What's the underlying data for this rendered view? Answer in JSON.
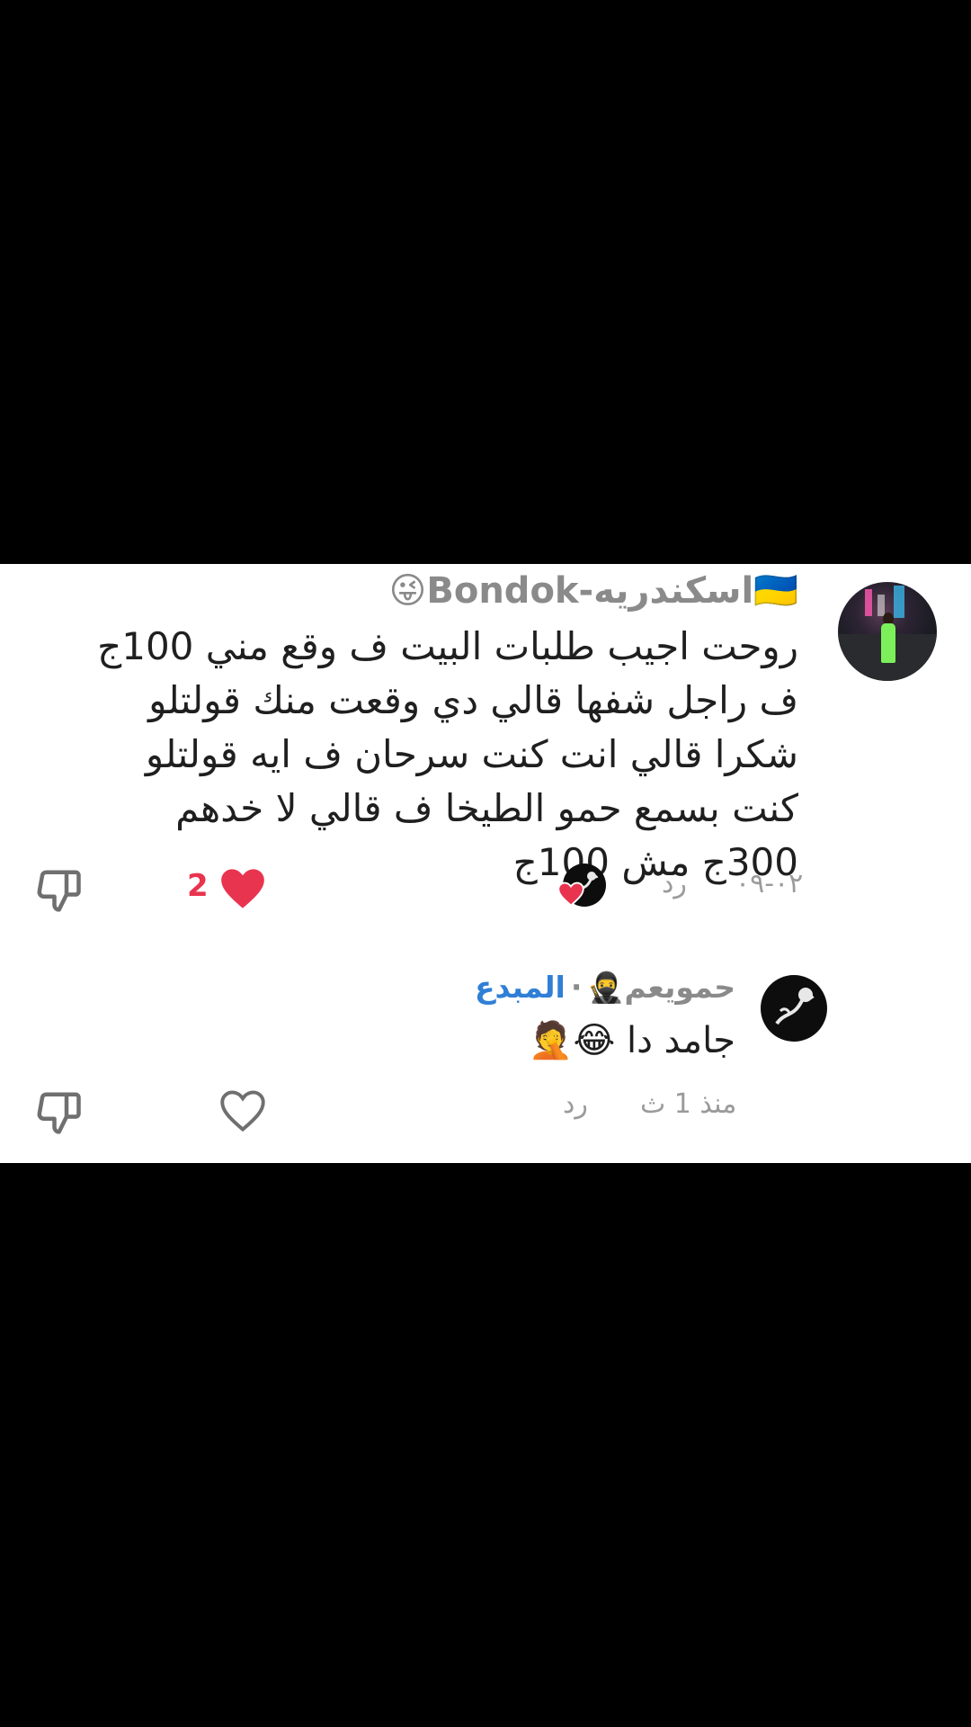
{
  "comment1": {
    "flag_icon": "🇺🇦",
    "username": "اسكندريه-Bondok",
    "username_emoji": "😜",
    "text": "روحت اجيب طلبات البيت ف وقع مني 100ج ف راجل شفها قالي دي وقعت منك قولتلو شكرا قالي انت كنت سرحان ف ايه قولتلو كنت بسمع حمو الطيخا ف قالي لا خدهم 300ج مش 100ج",
    "date": "٠٢-٠٩",
    "reply_label": "رد",
    "like_count": "2",
    "colors": {
      "like_active": "#e8344f"
    }
  },
  "comment2": {
    "username": "حمويعم",
    "username_emoji": "🥷",
    "separator": "·",
    "author_label": "المبدع",
    "text": "جامد دا",
    "text_emojis": "😂🤦",
    "time": "منذ 1 ث",
    "reply_label": "رد",
    "colors": {
      "author": "#2f7fd6"
    }
  }
}
